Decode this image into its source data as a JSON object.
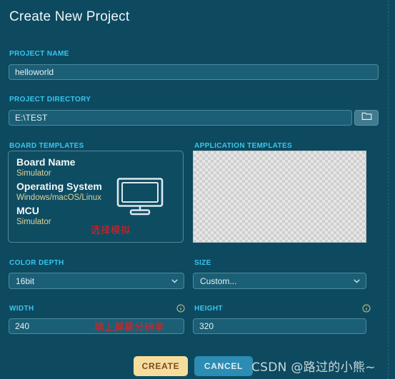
{
  "dialog": {
    "title": "Create New Project"
  },
  "colors": {
    "background": "#0d4a5f",
    "label_accent": "#39c6ef",
    "input_fill": "#1b5f76",
    "input_border": "#4e8a9d",
    "value_khaki": "#ddd49a",
    "annotation_red": "#ee1b1b",
    "create_button": "#f7dd9c",
    "cancel_button": "#2b8cb4"
  },
  "project_name": {
    "label": "PROJECT NAME",
    "value": "helloworld",
    "placeholder": "helloworld"
  },
  "project_directory": {
    "label": "PROJECT DIRECTORY",
    "value": "E:\\TEST",
    "placeholder": "E:\\TEST",
    "browse_icon": "folder-icon"
  },
  "board_templates": {
    "label": "BOARD TEMPLATES",
    "card": {
      "icon": "monitor-icon",
      "rows": [
        {
          "name": "Board Name",
          "value": "Simulator"
        },
        {
          "name": "Operating System",
          "value": "Windows/macOS/Linux"
        },
        {
          "name": "MCU",
          "value": "Simulator"
        }
      ]
    },
    "annotation": "选择模拟"
  },
  "application_templates": {
    "label": "APPLICATION TEMPLATES",
    "content": ""
  },
  "color_depth": {
    "label": "COLOR DEPTH",
    "value": "16bit",
    "chevron": "chevron-down-icon"
  },
  "size": {
    "label": "SIZE",
    "value": "Custom...",
    "chevron": "chevron-down-icon"
  },
  "width": {
    "label": "WIDTH",
    "value": "240",
    "placeholder": "240",
    "info_icon": "info-icon",
    "annotation": "填上屏幕分辨率"
  },
  "height": {
    "label": "HEIGHT",
    "value": "320",
    "placeholder": "320",
    "info_icon": "info-icon"
  },
  "footer": {
    "create_label": "CREATE",
    "cancel_label": "CANCEL",
    "watermark": "CSDN @路过的小熊~"
  }
}
